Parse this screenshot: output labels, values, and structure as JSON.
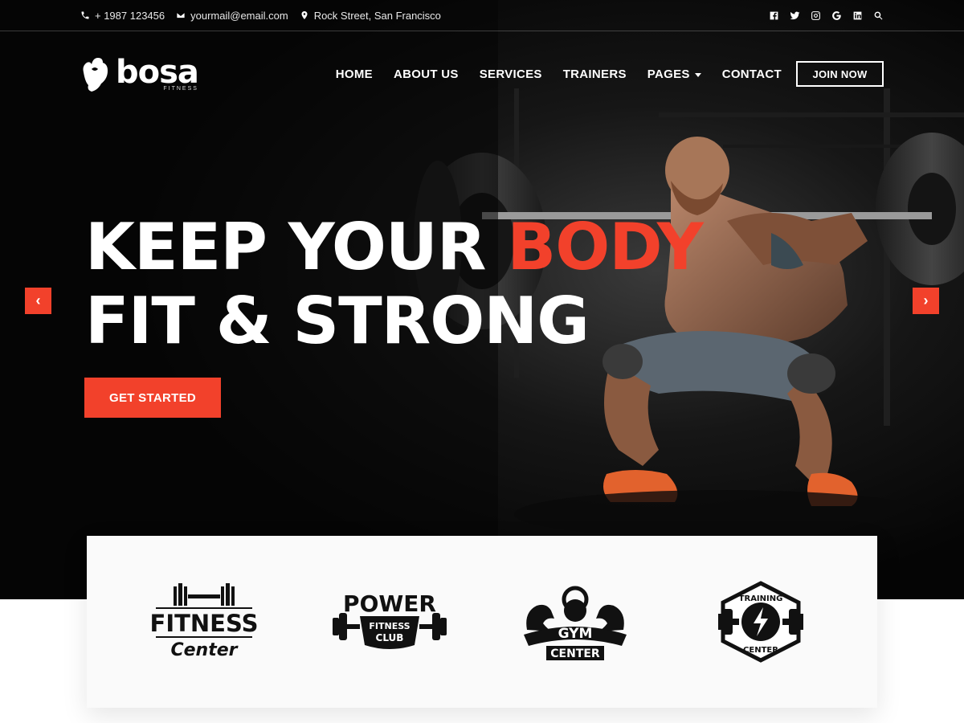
{
  "topbar": {
    "phone": "+ 1987 123456",
    "email": "yourmail@email.com",
    "address": "Rock Street, San Francisco",
    "social": [
      "facebook-icon",
      "twitter-icon",
      "instagram-icon",
      "google-icon",
      "linkedin-icon",
      "search-icon"
    ]
  },
  "brand": {
    "name": "bosa",
    "tagline": "FITNESS"
  },
  "nav": {
    "items": [
      "HOME",
      "ABOUT US",
      "SERVICES",
      "TRAINERS",
      "PAGES",
      "CONTACT"
    ],
    "join_label": "JOIN NOW"
  },
  "hero": {
    "line1_prefix": "KEEP YOUR",
    "line1_accent": "BODY",
    "line2": "FIT & STRONG",
    "cta_label": "GET STARTED",
    "prev_label": "‹",
    "next_label": "›"
  },
  "partners": [
    {
      "line1": "FITNESS",
      "line2": "Center"
    },
    {
      "line1": "POWER",
      "line2": "FITNESS",
      "line3": "CLUB"
    },
    {
      "line1": "GYM",
      "line2": "CENTER"
    },
    {
      "line1": "TRAINING",
      "line2": "CENTER"
    }
  ],
  "colors": {
    "accent": "#f2412b",
    "dark": "#050505",
    "strip_bg": "#fafafa"
  }
}
